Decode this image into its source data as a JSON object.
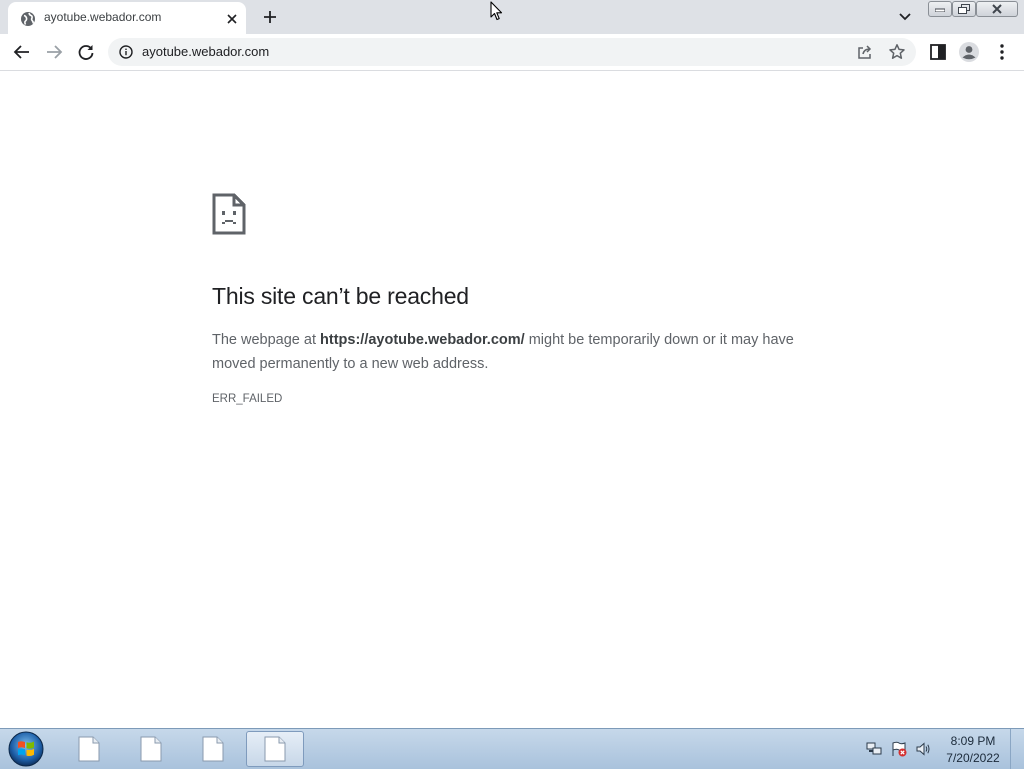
{
  "browser": {
    "tab": {
      "title": "ayotube.webador.com"
    },
    "address_bar": {
      "url": "ayotube.webador.com"
    }
  },
  "error_page": {
    "heading": "This site can’t be reached",
    "body_prefix": "The webpage at ",
    "body_url": "https://ayotube.webador.com/",
    "body_suffix": " might be temporarily down or it may have moved permanently to a new web address.",
    "error_code": "ERR_FAILED"
  },
  "taskbar": {
    "clock_time": "8:09 PM",
    "clock_date": "7/20/2022"
  },
  "icons": {
    "tab_favicon": "globe-icon",
    "tab_close": "close-icon",
    "new_tab": "plus-icon",
    "tab_search": "chevron-down-icon",
    "back": "arrow-left-icon",
    "forward": "arrow-right-icon",
    "reload": "reload-icon",
    "site_info": "info-icon",
    "share": "share-icon",
    "bookmark": "star-icon",
    "side_panel": "side-panel-icon",
    "profile": "profile-icon",
    "menu": "kebab-menu-icon",
    "error": "sad-page-icon"
  },
  "colors": {
    "tabstrip_bg": "#dee1e6",
    "omnibox_bg": "#f1f3f4",
    "heading_text": "#202124",
    "body_text": "#5f6368",
    "taskbar_bg": "#b8cde2"
  }
}
